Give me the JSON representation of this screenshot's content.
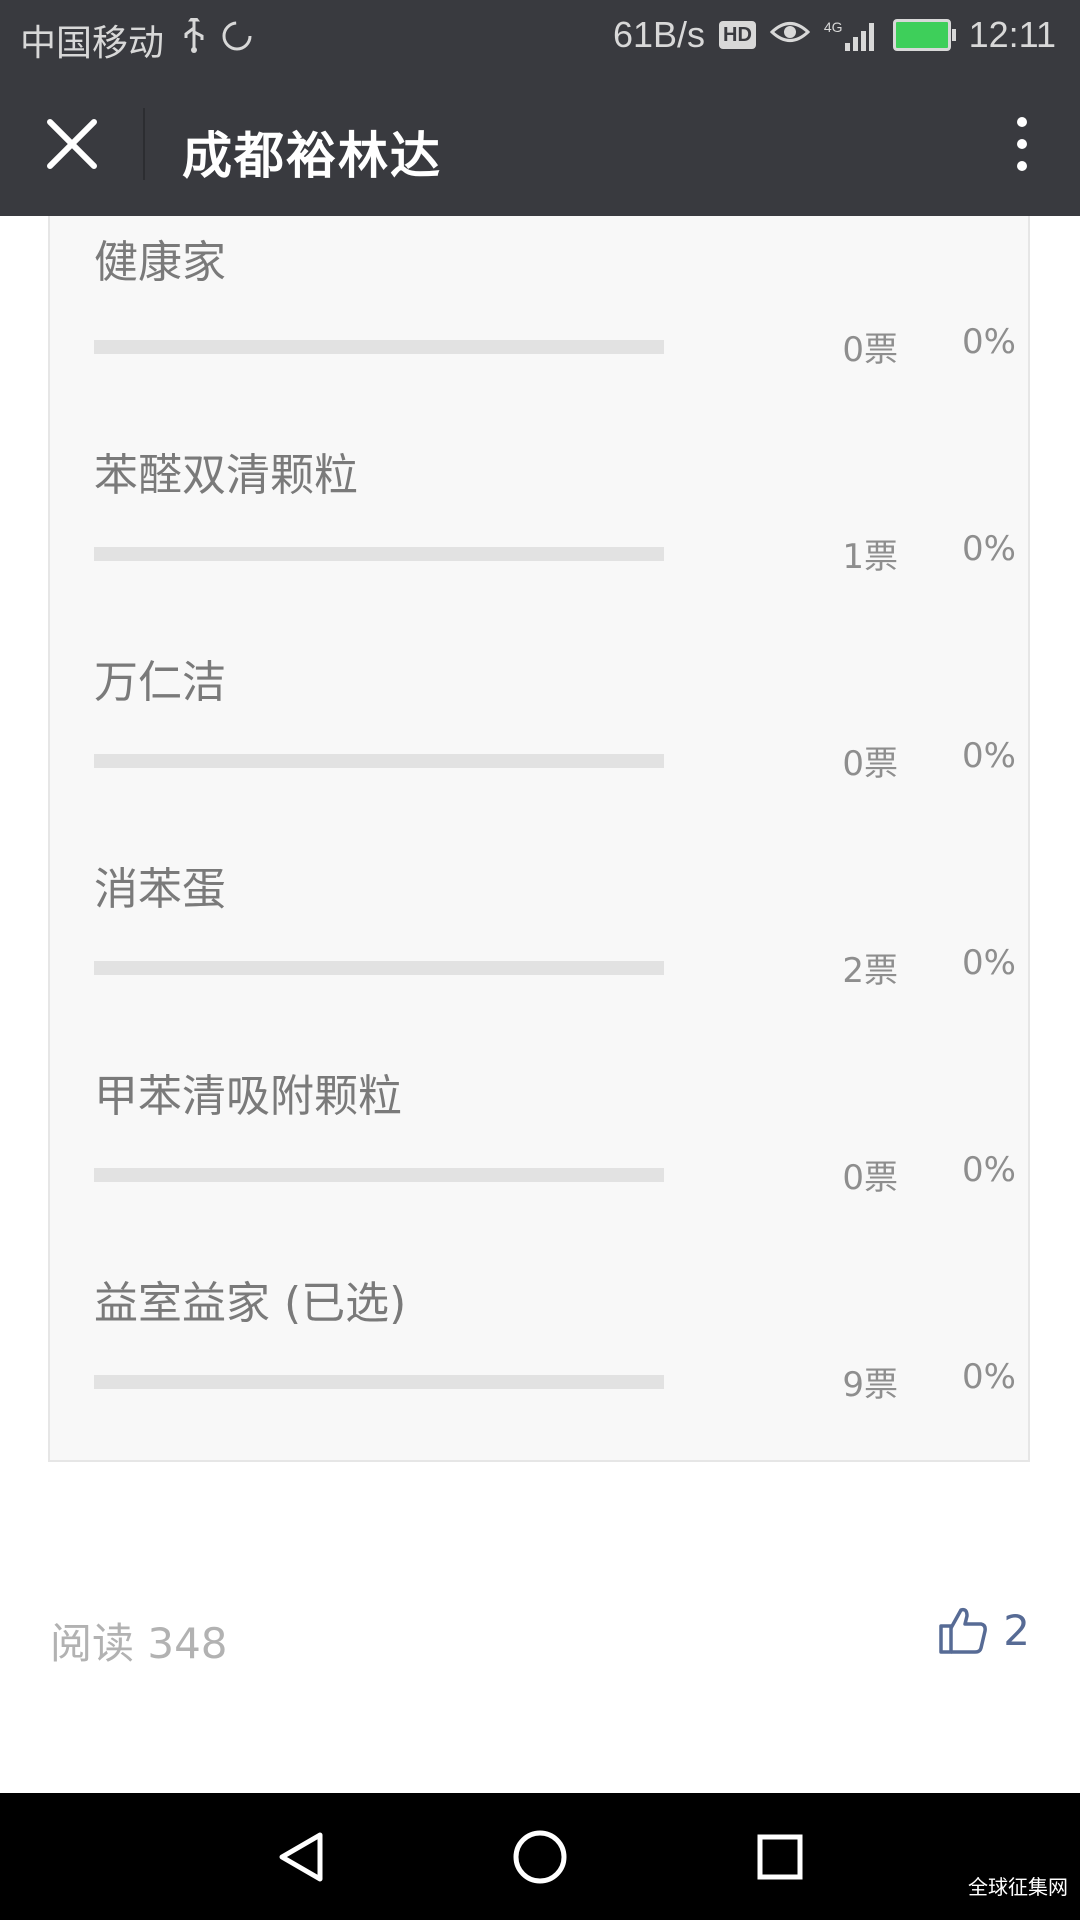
{
  "status_bar": {
    "carrier": "中国移动",
    "icons": [
      "usb-icon",
      "sync-icon"
    ],
    "net_speed": "61B/s",
    "hd_label": "HD",
    "network_type": "4G",
    "time": "12:11"
  },
  "title_bar": {
    "title": "成都裕林达"
  },
  "poll": {
    "options": [
      {
        "name": "健康家",
        "votes": "0票",
        "percent": "0%"
      },
      {
        "name": "苯醛双清颗粒",
        "votes": "1票",
        "percent": "0%"
      },
      {
        "name": "万仁洁",
        "votes": "0票",
        "percent": "0%"
      },
      {
        "name": "消苯蛋",
        "votes": "2票",
        "percent": "0%"
      },
      {
        "name": "甲苯清吸附颗粒",
        "votes": "0票",
        "percent": "0%"
      },
      {
        "name": "益室益家 (已选)",
        "votes": "9票",
        "percent": "0%"
      }
    ]
  },
  "footer": {
    "read_label": "阅读 348",
    "like_count": "2"
  },
  "watermark": "全球征集网",
  "colors": {
    "header_bg": "#393a3f",
    "link_blue": "#576b95",
    "card_bg": "#f8f8f8"
  }
}
